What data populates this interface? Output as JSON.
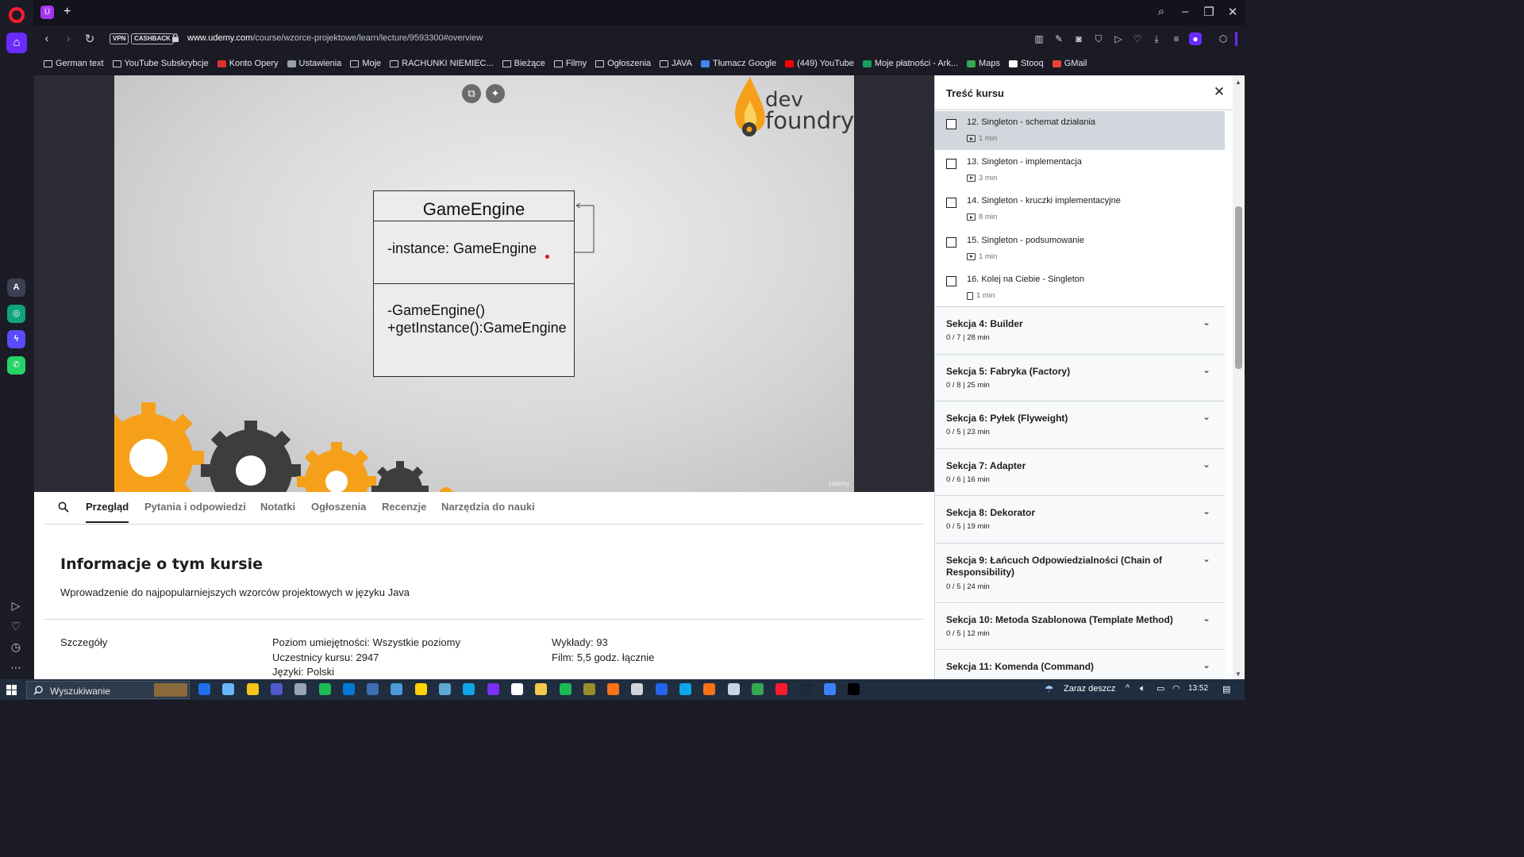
{
  "browser": {
    "url_domain": "www.udemy.com",
    "url_path": "/course/wzorce-projektowe/learn/lecture/9593300#overview",
    "vpn_label": "VPN",
    "cashback_label": "CASHBACK",
    "tab_favicon": "Ü",
    "bookmarks": [
      {
        "label": "German text",
        "icon": "folder-icon"
      },
      {
        "label": "YouTube Subskrybcje",
        "icon": "folder-icon"
      },
      {
        "label": "Konto Opery",
        "icon": "opera-icon",
        "color": "#e0312f"
      },
      {
        "label": "Ustawienia",
        "icon": "gear-icon",
        "color": "#9aa0ad"
      },
      {
        "label": "Moje",
        "icon": "folder-icon"
      },
      {
        "label": "RACHUNKI NIEMIEC...",
        "icon": "folder-icon"
      },
      {
        "label": "Bieżące",
        "icon": "folder-icon"
      },
      {
        "label": "Filmy",
        "icon": "folder-icon"
      },
      {
        "label": "Ogłoszenia",
        "icon": "folder-icon"
      },
      {
        "label": "JAVA",
        "icon": "folder-icon"
      },
      {
        "label": "Tłumacz Google",
        "icon": "google-translate-icon",
        "color": "#4285f4"
      },
      {
        "label": "(449) YouTube",
        "icon": "youtube-icon",
        "color": "#ff0000"
      },
      {
        "label": "Moje płatności - Ark...",
        "icon": "spreadsheet-icon",
        "color": "#18a05a"
      },
      {
        "label": "Maps",
        "icon": "maps-icon",
        "color": "#34a853"
      },
      {
        "label": "Stooq",
        "icon": "stooq-icon",
        "color": "#ffffff"
      },
      {
        "label": "GMail",
        "icon": "gmail-icon",
        "color": "#ea4335"
      }
    ]
  },
  "slide": {
    "logo_line1": "dev",
    "logo_line2": "foundry",
    "uml_class": "GameEngine",
    "uml_attribute": "-instance: GameEngine",
    "uml_op1": "-GameEngine()",
    "uml_op2": "+getInstance():GameEngine",
    "watermark": "Udemy",
    "brand_orange": "#f6a01a",
    "gear_dark": "#3d3d3d"
  },
  "content_tabs": [
    "Przegląd",
    "Pytania i odpowiedzi",
    "Notatki",
    "Ogłoszenia",
    "Recenzje",
    "Narzędzia do nauki"
  ],
  "info": {
    "title": "Informacje o tym kursie",
    "description": "Wprowadzenie do najpopularniejszych wzorców projektowych w języku Java",
    "details_label": "Szczegóły",
    "level": "Poziom umiejętności: Wszystkie poziomy",
    "students": "Uczestnicy kursu: 2947",
    "languages": "Języki: Polski",
    "lectures": "Wykłady: 93",
    "video": "Film: 5,5 godz. łącznie"
  },
  "panel": {
    "title": "Treść kursu",
    "lectures": [
      {
        "title": "12. Singleton - schemat działania",
        "duration": "1 min",
        "type": "video",
        "current": true
      },
      {
        "title": "13. Singleton - implementacja",
        "duration": "3 min",
        "type": "video",
        "current": false
      },
      {
        "title": "14. Singleton - kruczki implementacyjne",
        "duration": "8 min",
        "type": "video",
        "current": false
      },
      {
        "title": "15. Singleton - podsumowanie",
        "duration": "1 min",
        "type": "video",
        "current": false
      },
      {
        "title": "16. Kolej na Ciebie - Singleton",
        "duration": "1 min",
        "type": "article",
        "current": false
      }
    ],
    "sections": [
      {
        "title": "Sekcja 4: Builder",
        "meta": "0 / 7 | 28 min"
      },
      {
        "title": "Sekcja 5: Fabryka (Factory)",
        "meta": "0 / 8 | 25 min"
      },
      {
        "title": "Sekcja 6: Pyłek (Flyweight)",
        "meta": "0 / 5 | 23 min"
      },
      {
        "title": "Sekcja 7: Adapter",
        "meta": "0 / 6 | 16 min"
      },
      {
        "title": "Sekcja 8: Dekorator",
        "meta": "0 / 5 | 19 min"
      },
      {
        "title": "Sekcja 9: Łańcuch Odpowiedzialności (Chain of Responsibility)",
        "meta": "0 / 5 | 24 min"
      },
      {
        "title": "Sekcja 10: Metoda Szablonowa (Template Method)",
        "meta": "0 / 5 | 12 min"
      },
      {
        "title": "Sekcja 11: Komenda (Command)",
        "meta": ""
      }
    ]
  },
  "taskbar": {
    "search_placeholder": "Wyszukiwanie",
    "weather": "Zaraz deszcz",
    "time": "13:52"
  }
}
